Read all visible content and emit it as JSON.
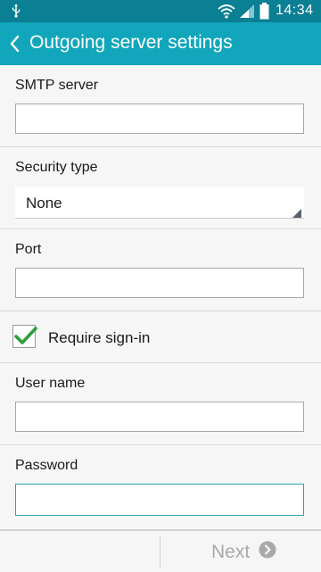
{
  "status_bar": {
    "time": "14:34",
    "icons": [
      "usb-icon",
      "wifi-icon",
      "signal-icon",
      "battery-icon"
    ]
  },
  "app_bar": {
    "title": "Outgoing server settings",
    "back_icon": "chevron-left-icon"
  },
  "form": {
    "smtp_server": {
      "label": "SMTP server",
      "value": "",
      "placeholder": ""
    },
    "security_type": {
      "label": "Security type",
      "value": "None"
    },
    "port": {
      "label": "Port",
      "value": "",
      "placeholder": ""
    },
    "require_signin": {
      "label": "Require sign-in",
      "checked": true
    },
    "user_name": {
      "label": "User name",
      "value": "",
      "placeholder": ""
    },
    "password": {
      "label": "Password",
      "value": "",
      "placeholder": ""
    }
  },
  "footer": {
    "next_label": "Next",
    "next_icon": "chevron-right-circle-icon"
  },
  "colors": {
    "status_bar": "#0b7f93",
    "app_bar": "#11a6bb",
    "checkmark": "#2c9e3a",
    "focus_border": "#2ba3b8",
    "disabled_text": "#a9a9a9"
  }
}
